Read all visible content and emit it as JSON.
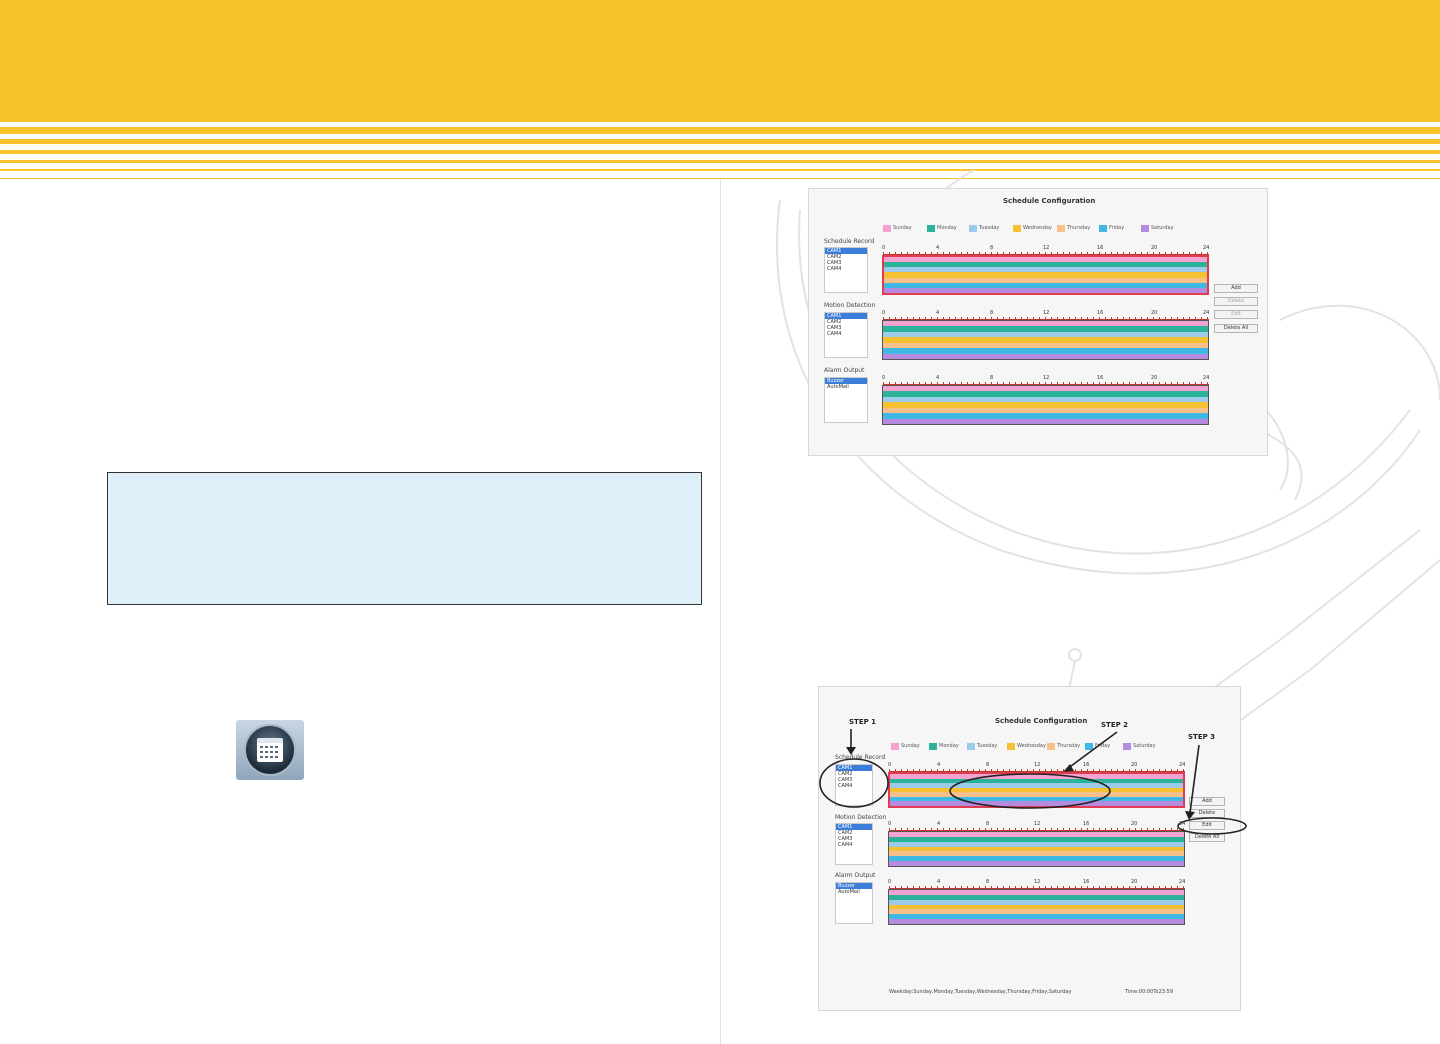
{
  "colors": {
    "header": "#f8c22b",
    "note_bg": "#dfeffa"
  },
  "calendar_button": {
    "icon": "calendar-icon"
  },
  "schedule_top": {
    "title": "Schedule Configuration",
    "legend": [
      {
        "label": "Sunday",
        "color": "#f2a3d2"
      },
      {
        "label": "Monday",
        "color": "#2bb39a"
      },
      {
        "label": "Tuesday",
        "color": "#9ccbea"
      },
      {
        "label": "Wednesday",
        "color": "#f5c132"
      },
      {
        "label": "Thursday",
        "color": "#f7c08a"
      },
      {
        "label": "Friday",
        "color": "#3fb8e3"
      },
      {
        "label": "Saturday",
        "color": "#b58be0"
      }
    ],
    "sections": [
      {
        "label": "Schedule Record",
        "items": [
          "CAM1",
          "CAM2",
          "CAM3",
          "CAM4"
        ],
        "selected": 0
      },
      {
        "label": "Motion Detection",
        "items": [
          "CAM1",
          "CAM2",
          "CAM3",
          "CAM4"
        ],
        "selected": 0
      },
      {
        "label": "Alarm Output",
        "items": [
          "Buzzer",
          "AutoMail"
        ],
        "selected": 0
      }
    ],
    "ticks": [
      "0",
      "4",
      "8",
      "12",
      "16",
      "20",
      "24"
    ],
    "buttons": {
      "add": "Add",
      "delete": "Delete",
      "edit": "Edit",
      "delete_all": "Delete All"
    }
  },
  "schedule_bottom": {
    "title": "Schedule Configuration",
    "steps": {
      "step1": "STEP 1",
      "step2": "STEP 2",
      "step3": "STEP 3"
    },
    "weekday_text": "Weekday:Sunday,Monday,Tuesday,Wednesday,Thursday,Friday,Saturday",
    "time_text": "Time:00:00To23:59"
  }
}
